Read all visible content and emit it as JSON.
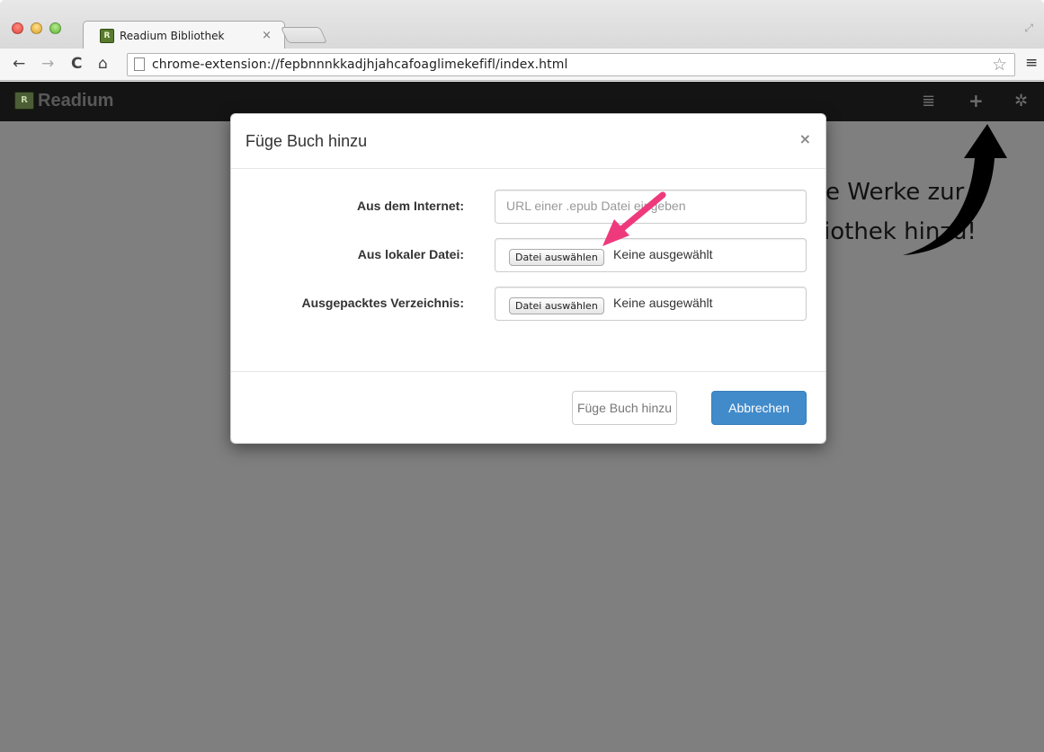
{
  "browser": {
    "tab_title": "Readium Bibliothek",
    "tab_close": "×",
    "favicon_text": "R",
    "url": "chrome-extension://fepbnnnkkadjhjahcafoaglimekefifl/index.html",
    "icons": {
      "back": "←",
      "forward": "→",
      "reload": "C",
      "home": "⌂",
      "star": "☆",
      "menu": "≡",
      "fullscreen": "⤢"
    }
  },
  "app": {
    "brand": "Readium",
    "brand_logo_text": "R",
    "navbar_icons": {
      "list": "≣",
      "add": "+",
      "settings": "✲"
    },
    "background_text": {
      "line1": "e Werke zur",
      "line2": "iothek hinzu!"
    }
  },
  "modal": {
    "title": "Füge Buch hinzu",
    "close": "×",
    "fields": {
      "internet_label": "Aus dem Internet:",
      "internet_placeholder": "URL einer .epub Datei eingeben",
      "local_label": "Aus lokaler Datei:",
      "local_button": "Datei auswählen",
      "local_status": "Keine ausgewählt",
      "dir_label": "Ausgepacktes Verzeichnis:",
      "dir_button": "Datei auswählen",
      "dir_status": "Keine ausgewählt"
    },
    "buttons": {
      "add": "Füge Buch hinzu",
      "cancel": "Abbrechen"
    }
  },
  "colors": {
    "navbar": "#141414",
    "backdrop": "#7f7f7f",
    "primary": "#428bca",
    "annotation_pink": "#ee3a7c",
    "annotation_black": "#000000"
  }
}
